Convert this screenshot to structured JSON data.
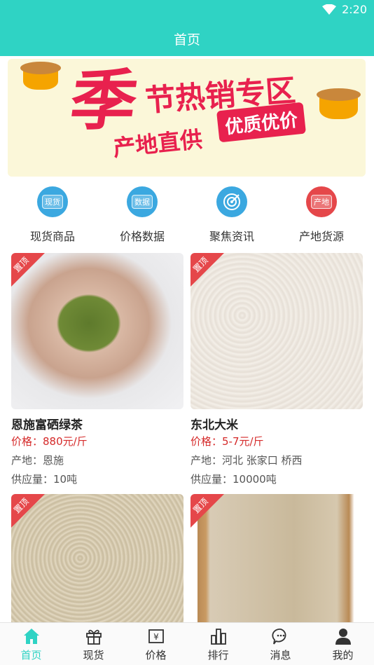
{
  "status": {
    "time": "2:20"
  },
  "header": {
    "title": "首页"
  },
  "banner": {
    "big_char": "季",
    "line1": "节热销专区",
    "line2": "产地直供",
    "tag": "优质优价"
  },
  "quick_nav": [
    {
      "label": "现货商品",
      "icon": "spot-goods-icon",
      "tag": "现货",
      "color": "#3ba8e0"
    },
    {
      "label": "价格数据",
      "icon": "price-data-icon",
      "tag": "数据",
      "color": "#3ba8e0"
    },
    {
      "label": "聚焦资讯",
      "icon": "focus-news-icon",
      "tag": "",
      "color": "#3ba8e0"
    },
    {
      "label": "产地货源",
      "icon": "origin-source-icon",
      "tag": "产地",
      "color": "#e5474a"
    }
  ],
  "products": [
    {
      "badge": "置顶",
      "name": "恩施富硒绿茶",
      "price": "价格：880元/斤",
      "origin": "产地：恩施",
      "supply": "供应量：10吨",
      "image": "green-tea-photo"
    },
    {
      "badge": "置顶",
      "name": "东北大米",
      "price": "价格：5-7元/斤",
      "origin": "产地：河北 张家口 桥西",
      "supply": "供应量：10000吨",
      "image": "rice-photo"
    },
    {
      "badge": "置顶",
      "image": "soybean-photo"
    },
    {
      "badge": "置顶",
      "image": "dried-slices-photo"
    }
  ],
  "tabs": [
    {
      "label": "首页",
      "icon": "home-icon",
      "active": true
    },
    {
      "label": "现货",
      "icon": "gift-icon",
      "active": false
    },
    {
      "label": "价格",
      "icon": "price-tag-icon",
      "active": false
    },
    {
      "label": "排行",
      "icon": "ranking-bars-icon",
      "active": false
    },
    {
      "label": "消息",
      "icon": "message-bubble-icon",
      "active": false
    },
    {
      "label": "我的",
      "icon": "user-icon",
      "active": false
    }
  ],
  "colors": {
    "accent": "#2fd3c4",
    "price": "#d52a2a",
    "badge": "#e5474a"
  }
}
